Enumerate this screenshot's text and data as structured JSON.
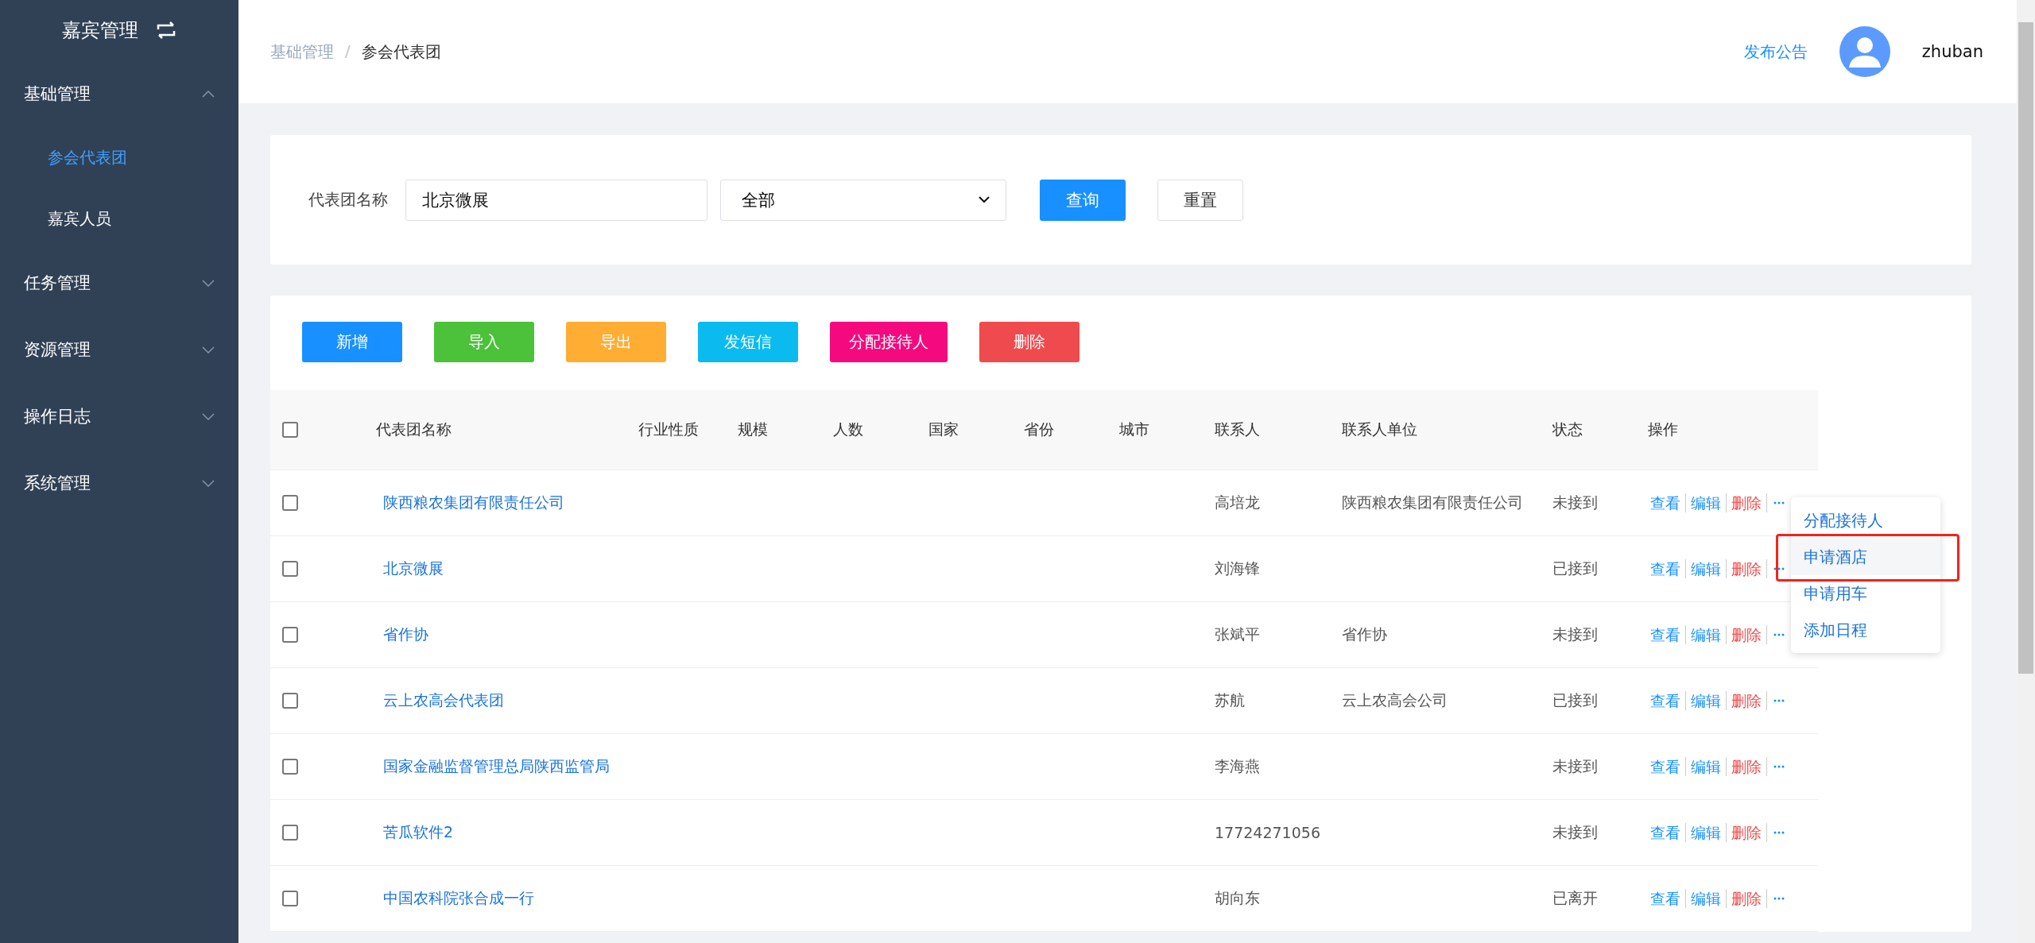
{
  "sidebar": {
    "title": "嘉宾管理",
    "items": [
      {
        "label": "基础管理",
        "expanded": true,
        "children": [
          {
            "label": "参会代表团",
            "selected": true
          },
          {
            "label": "嘉宾人员",
            "selected": false
          }
        ]
      },
      {
        "label": "任务管理",
        "expanded": false
      },
      {
        "label": "资源管理",
        "expanded": false
      },
      {
        "label": "操作日志",
        "expanded": false
      },
      {
        "label": "系统管理",
        "expanded": false
      }
    ]
  },
  "header": {
    "breadcrumb": [
      "基础管理",
      "参会代表团"
    ],
    "separator": "/",
    "announce_link": "发布公告",
    "username": "zhuban"
  },
  "filter": {
    "label": "代表团名称",
    "name_value": "北京微展",
    "status_value": "全部",
    "buttons": [
      {
        "label": "查询",
        "kind": "primary"
      },
      {
        "label": "重置",
        "kind": "default"
      }
    ]
  },
  "toolbar": [
    {
      "label": "新增",
      "color": "#1890ff"
    },
    {
      "label": "导入",
      "color": "#4cc13a"
    },
    {
      "label": "导出",
      "color": "#ffad33"
    },
    {
      "label": "发短信",
      "color": "#0bbbf0"
    },
    {
      "label": "分配接待人",
      "color": "#f5097f"
    },
    {
      "label": "删除",
      "color": "#ef4a4d"
    }
  ],
  "table": {
    "header_checked": false,
    "columns": [
      "代表团名称",
      "行业性质",
      "规模",
      "人数",
      "国家",
      "省份",
      "城市",
      "联系人",
      "联系人单位",
      "状态",
      "操作"
    ],
    "rows": [
      {
        "checked": false,
        "name": "陕西粮农集团有限责任公司",
        "contact": "高培龙",
        "contact_org": "陕西粮农集团有限责任公司",
        "status": "未接到",
        "actions": [
          "查看",
          "编辑",
          "删除"
        ]
      },
      {
        "checked": false,
        "name": "北京微展",
        "contact": "刘海锋",
        "status": "已接到",
        "actions": [
          "查看",
          "编辑",
          "删除"
        ]
      },
      {
        "checked": false,
        "name": "省作协",
        "contact": "张斌平",
        "contact_org": "省作协",
        "status": "未接到",
        "actions": [
          "查看",
          "编辑",
          "删除"
        ]
      },
      {
        "checked": false,
        "name": "云上农高会代表团",
        "contact": "苏航",
        "contact_org": "云上农高会公司",
        "status": "已接到",
        "actions": [
          "查看",
          "编辑",
          "删除"
        ]
      },
      {
        "checked": false,
        "name": "国家金融监督管理总局陕西监管局",
        "contact": "李海燕",
        "status": "未接到",
        "actions": [
          "查看",
          "编辑",
          "删除"
        ]
      },
      {
        "checked": false,
        "name": "苦瓜软件2",
        "contact": "17724271056",
        "status": "未接到",
        "actions": [
          "查看",
          "编辑",
          "删除"
        ]
      },
      {
        "checked": false,
        "name": "中国农科院张合成一行",
        "contact": "胡向东",
        "status": "已离开",
        "actions": [
          "查看",
          "编辑",
          "删除"
        ]
      }
    ]
  },
  "more_menu": {
    "items": [
      {
        "label": "分配接待人",
        "highlighted": false
      },
      {
        "label": "申请酒店",
        "highlighted": true
      },
      {
        "label": "申请用车",
        "highlighted": false
      },
      {
        "label": "添加日程",
        "highlighted": false
      }
    ]
  }
}
